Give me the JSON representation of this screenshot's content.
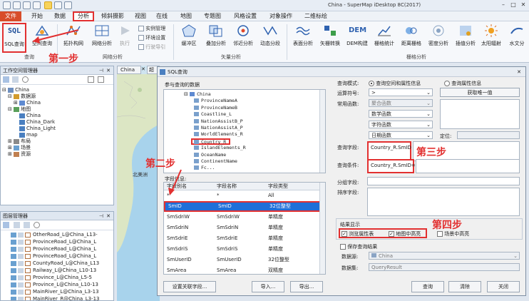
{
  "window": {
    "title": "China - SuperMap iDesktop 8C(2017)"
  },
  "menu": {
    "items": [
      "文件",
      "开始",
      "数据",
      "分析",
      "倾斜摄影",
      "视图",
      "在线",
      "地图",
      "专题图",
      "风格设置",
      "对象操作",
      "二维标绘"
    ]
  },
  "ribbon": {
    "query_buttons": [
      "SQL查询",
      "空间查询"
    ],
    "network_buttons": [
      "拓扑构网",
      "网络分析",
      "执行"
    ],
    "network_options": [
      "实例管理",
      "环境设置",
      "行驶导引"
    ],
    "vector_buttons": [
      "缓冲区",
      "叠加分析",
      "邻近分析",
      "动态分段"
    ],
    "raster_buttons": [
      "表面分析",
      "矢栅转换",
      "DEM构建",
      "栅格统计",
      "距离栅格",
      "密度分析",
      "插值分析",
      "太阳辐射",
      "水文分"
    ],
    "groups": [
      "查询",
      "网络分析",
      "矢量分析",
      "栅格分析"
    ]
  },
  "workspace_panel": {
    "title": "工作空间管理器",
    "tree": [
      "China",
      "数据源",
      "China",
      "地图",
      "China",
      "China_Dark",
      "China_Light",
      "map",
      "布局",
      "场景",
      "资源"
    ]
  },
  "layer_panel": {
    "title": "图层管理器",
    "layers": [
      "OtherRoad_L@China_L13-",
      "ProvinceRoad_L@China_L",
      "ProvinceRoad_L@China_L",
      "ProvinceRoad_L@China_L",
      "CountyRoad_L@China_L13",
      "Railway_L@China_L10-13",
      "Province_L@China_L5-5",
      "Province_L@China_L10-13",
      "MainRiver_L@China_L3-13",
      "MainRiver_R@China_L3-13"
    ]
  },
  "map": {
    "tab": "China",
    "tab2": "超",
    "label_region": "北美洲"
  },
  "dialog": {
    "title": "SQL查询",
    "data_label": "参与查询的数据",
    "data_tree": [
      "China",
      "ProvinceNameA",
      "ProvinceNameB",
      "Coastline_L",
      "NationAssistB_P",
      "NationAssistA_P",
      "WorldElements_R",
      "Country_R",
      "IslandElements_R",
      "OceanName",
      "ContinentName",
      "Fc..."
    ],
    "field_info_label": "字段信息:",
    "field_headers": [
      "字段别名",
      "字段名称",
      "字段类型"
    ],
    "fields": [
      {
        "alias": "*",
        "name": "*",
        "type": "All"
      },
      {
        "alias": "SmID",
        "name": "SmID",
        "type": "32位整型"
      },
      {
        "alias": "SmSdriW",
        "name": "SmSdriW",
        "type": "单精度"
      },
      {
        "alias": "SmSdriN",
        "name": "SmSdriN",
        "type": "单精度"
      },
      {
        "alias": "SmSdriE",
        "name": "SmSdriE",
        "type": "单精度"
      },
      {
        "alias": "SmSdriS",
        "name": "SmSdriS",
        "type": "单精度"
      },
      {
        "alias": "SmUserID",
        "name": "SmUserID",
        "type": "32位整型"
      },
      {
        "alias": "SmArea",
        "name": "SmArea",
        "type": "双精度"
      }
    ],
    "query_mode_label": "查询模式:",
    "mode_spatial": "查询空间和属性信息",
    "mode_attr": "查询属性信息",
    "operator_label": "运算符号:",
    "operator_value": ">",
    "get_unique_button": "获取唯一值",
    "functions_label": "常用函数:",
    "functions": [
      "聚合函数",
      "数学函数",
      "字符函数",
      "日期函数"
    ],
    "locate_label": "定位:",
    "query_field_label": "查询字段:",
    "query_field_value": "Country_R.SmID",
    "query_condition_label": "查询条件:",
    "query_condition_value": "Country_R.SmID=1",
    "group_field_label": "分组字段:",
    "sort_field_label": "排序字段:",
    "result_label": "结果显示",
    "browse_table": "浏览属性表",
    "map_highlight": "地图中高亮",
    "scene_highlight": "场景中高亮",
    "save_result": "保存查询结果",
    "datasource_label": "数据源:",
    "datasource_value": "China",
    "dataset_label": "数据集:",
    "dataset_value": "QueryResult",
    "btn_set_join": "设置关联字段...",
    "btn_import": "导入...",
    "btn_export": "导出...",
    "btn_query": "查询",
    "btn_clear": "清除",
    "btn_close": "关闭"
  },
  "annotations": {
    "step1": "第一步",
    "step2": "第二步",
    "step3": "第三步",
    "step4": "第四步"
  },
  "colors": {
    "accent_red": "#e23030",
    "selection_blue": "#1f6fd8",
    "file_menu": "#d84d2a"
  }
}
